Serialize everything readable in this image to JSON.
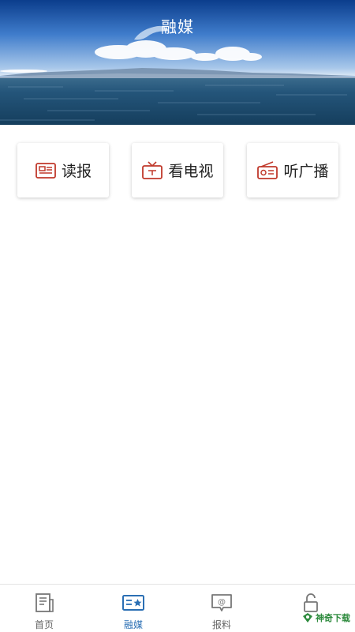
{
  "header": {
    "title": "融媒"
  },
  "cards": [
    {
      "label": "读报",
      "icon": "newspaper-icon"
    },
    {
      "label": "看电视",
      "icon": "tv-icon"
    },
    {
      "label": "听广播",
      "icon": "radio-icon"
    }
  ],
  "tabs": [
    {
      "label": "首页",
      "icon": "home-doc-icon",
      "active": false
    },
    {
      "label": "融媒",
      "icon": "media-card-icon",
      "active": true
    },
    {
      "label": "报料",
      "icon": "report-chat-icon",
      "active": false
    },
    {
      "label": "",
      "icon": "lock-icon",
      "active": false
    }
  ],
  "watermark": {
    "text": "神奇下载"
  },
  "colors": {
    "accent": "#2b6fb4",
    "icon_red": "#c0392b",
    "tab_inactive": "#666666"
  }
}
